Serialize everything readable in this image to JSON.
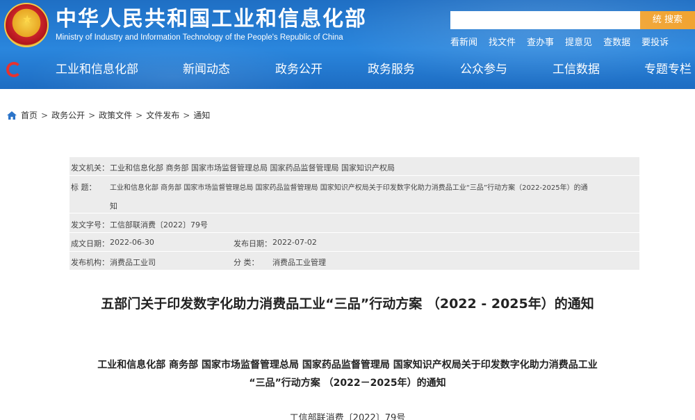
{
  "header": {
    "title": "中华人民共和国工业和信息化部",
    "subtitle": "Ministry of Industry and Information Technology of the People's Republic of China",
    "search_button": "统  搜索",
    "quick_links": [
      "看新闻",
      "找文件",
      "查办事",
      "提意见",
      "查数据",
      "要投诉"
    ]
  },
  "nav": {
    "items": [
      "工业和信息化部",
      "新闻动态",
      "政务公开",
      "政务服务",
      "公众参与",
      "工信数据",
      "专题专栏"
    ]
  },
  "breadcrumb": [
    "首页",
    "政务公开",
    "政策文件",
    "文件发布",
    "通知"
  ],
  "meta": {
    "issuer_label": "发文机关：",
    "issuer": "工业和信息化部 商务部 国家市场监督管理总局 国家药品监督管理局 国家知识产权局",
    "title_label": "标    题：",
    "title_line1": "工业和信息化部 商务部 国家市场监督管理总局 国家药品监督管理局 国家知识产权局关于印发数字化助力消费品工业“三品”行动方案（2022-2025年）的通",
    "title_line2": "知",
    "doc_no_label": "发文字号：",
    "doc_no": "工信部联消费〔2022〕79号",
    "date_label": "成文日期：",
    "date": "2022-06-30",
    "pub_label": "发布日期：",
    "pub_date": "2022-07-02",
    "org_label": "发布机构：",
    "org": "消费品工业司",
    "cat_label": "分    类：",
    "category": "消费品工业管理"
  },
  "document": {
    "title": "五部门关于印发数字化助力消费品工业“三品”行动方案 （2022 - 2025年）的通知",
    "head_line1": "工业和信息化部 商务部 国家市场监督管理总局 国家药品监督管理局 国家知识产权局关于印发数字化助力消费品工业",
    "head_line2": "“三品”行动方案 （2022－2025年）的通知",
    "number": "工信部联消费〔2022〕79号"
  },
  "colors": {
    "header_blue": "#2a86dd",
    "search_orange": "#f0a02a",
    "meta_bg": "#ececec"
  }
}
